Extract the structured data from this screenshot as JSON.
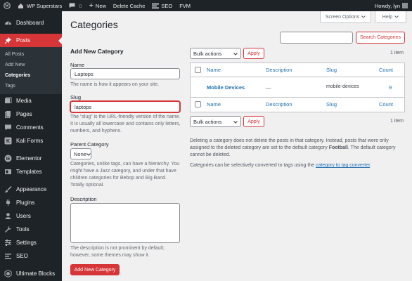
{
  "adminbar": {
    "site_name": "WP Superstars",
    "comments_count": "0",
    "new_label": "New",
    "delete_cache_label": "Delete Cache",
    "seo_label": "SEO",
    "fvm_label": "FVM",
    "howdy": "Howdy, lyn"
  },
  "sidebar": {
    "dashboard": "Dashboard",
    "posts": "Posts",
    "posts_sub": [
      "All Posts",
      "Add New",
      "Categories",
      "Tags"
    ],
    "media": "Media",
    "pages": "Pages",
    "comments": "Comments",
    "kali_forms": "Kali Forms",
    "elementor": "Elementor",
    "templates": "Templates",
    "appearance": "Appearance",
    "plugins": "Plugins",
    "users": "Users",
    "tools": "Tools",
    "settings": "Settings",
    "seo": "SEO",
    "ultimate_blocks": "Ultimate Blocks"
  },
  "header": {
    "title": "Categories",
    "screen_options": "Screen Options",
    "help": "Help"
  },
  "search": {
    "value": "",
    "button": "Search Categories"
  },
  "form": {
    "title": "Add New Category",
    "name_label": "Name",
    "name_value": "Laptops",
    "name_help": "The name is how it appears on your site.",
    "slug_label": "Slug",
    "slug_value": "laptops",
    "slug_help": "The “slug” is the URL-friendly version of the name. It is usually all lowercase and contains only letters, numbers, and hyphens.",
    "parent_label": "Parent Category",
    "parent_value": "None",
    "parent_help": "Categories, unlike tags, can have a hierarchy. You might have a Jazz category, and under that have children categories for Bebop and Big Band. Totally optional.",
    "description_label": "Description",
    "description_value": "",
    "description_help": "The description is not prominent by default; however, some themes may show it.",
    "submit": "Add New Category"
  },
  "table": {
    "bulk_actions": "Bulk actions",
    "apply": "Apply",
    "item_count": "1 item",
    "columns": [
      "Name",
      "Description",
      "Slug",
      "Count"
    ],
    "rows": [
      {
        "name": "Mobile Devices",
        "description": "—",
        "slug": "mobile-devices",
        "count": "9"
      }
    ]
  },
  "notes": {
    "p1_before": "Deleting a category does not delete the posts in that category. Instead, posts that were only assigned to the deleted category are set to the default category ",
    "p1_bold": "Football",
    "p1_after": ". The default category cannot be deleted.",
    "p2_before": "Categories can be selectively converted to tags using the ",
    "p2_link": "category to tag converter",
    "p2_after": "."
  },
  "colors": {
    "accent": "#d63638",
    "link": "#2271b1",
    "sidebar_bg": "#1d2327"
  }
}
